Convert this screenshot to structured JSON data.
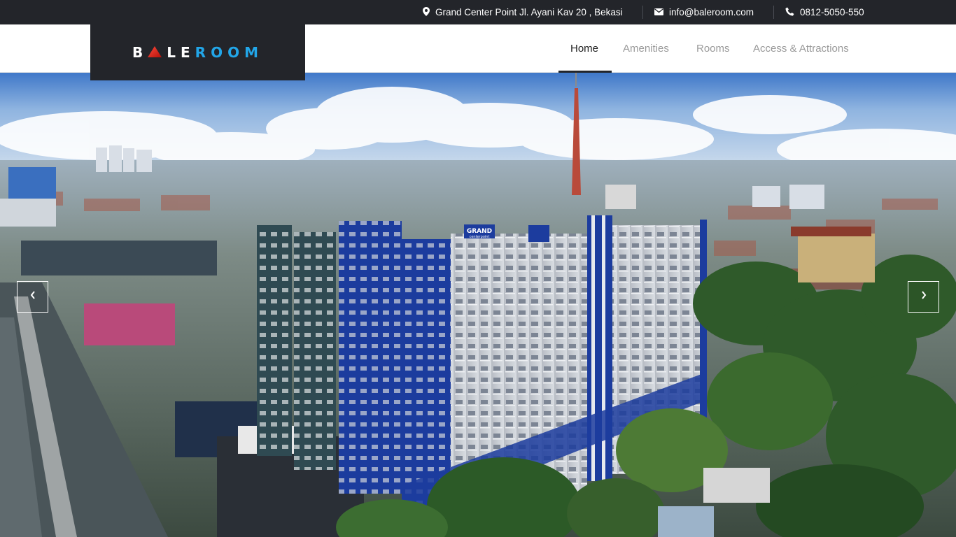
{
  "topbar": {
    "address": "Grand Center Point Jl. Ayani Kav 20 , Bekasi",
    "email": "info@baleroom.com",
    "phone": "0812-5050-550"
  },
  "logo": {
    "letters_left": "B",
    "letters_mid": "LE",
    "letters_right": "ROOM",
    "accent": "#e0261c",
    "blue": "#22a6e8"
  },
  "nav": {
    "items": [
      {
        "label": "Home",
        "active": true
      },
      {
        "label": "Amenities",
        "active": false
      },
      {
        "label": "Rooms",
        "active": false
      },
      {
        "label": "Access & Attractions",
        "active": false
      }
    ]
  },
  "hero": {
    "building_sign": "GRAND",
    "building_sign_sub": "centerpoint"
  },
  "icons": {
    "address": "map-marker-icon",
    "email": "envelope-icon",
    "phone": "phone-icon",
    "prev": "chevron-left-icon",
    "next": "chevron-right-icon"
  }
}
